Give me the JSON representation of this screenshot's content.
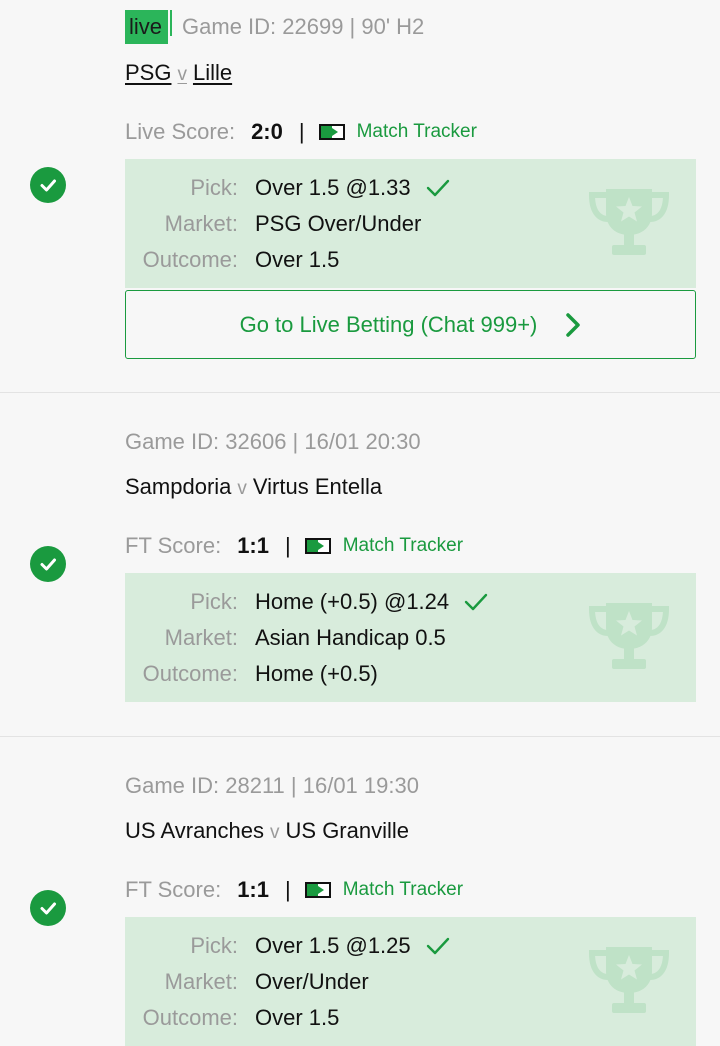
{
  "bets": [
    {
      "live_badge": "live",
      "header": "Game ID: 22699 | 90' H2",
      "home": "PSG",
      "vs": "v",
      "away": "Lille",
      "score_label": "Live Score:",
      "score": "2:0",
      "divider": "|",
      "tracker_label": "Match Tracker",
      "pick_label": "Pick:",
      "pick": "Over 1.5 @1.33",
      "market_label": "Market:",
      "market": "PSG Over/Under",
      "outcome_label": "Outcome:",
      "outcome": "Over 1.5",
      "button_label": "Go to Live Betting (Chat 999+)",
      "status": "won"
    },
    {
      "header": "Game ID: 32606 | 16/01 20:30",
      "home": "Sampdoria",
      "vs": "v",
      "away": "Virtus Entella",
      "score_label": "FT Score:",
      "score": "1:1",
      "divider": "|",
      "tracker_label": "Match Tracker",
      "pick_label": "Pick:",
      "pick": "Home (+0.5) @1.24",
      "market_label": "Market:",
      "market": "Asian Handicap 0.5",
      "outcome_label": "Outcome:",
      "outcome": "Home (+0.5)",
      "status": "won"
    },
    {
      "header": "Game ID: 28211 | 16/01 19:30",
      "home": "US Avranches",
      "vs": "v",
      "away": "US Granville",
      "score_label": "FT Score:",
      "score": "1:1",
      "divider": "|",
      "tracker_label": "Match Tracker",
      "pick_label": "Pick:",
      "pick": "Over 1.5 @1.25",
      "market_label": "Market:",
      "market": "Over/Under",
      "outcome_label": "Outcome:",
      "outcome": "Over 1.5",
      "status": "won"
    }
  ],
  "colors": {
    "accent": "#1a9a3f",
    "live_badge": "#2bb55a",
    "pick_box": "#d8ecdc",
    "muted_text": "#9a9a9a",
    "background": "#f7f7f7"
  },
  "icons": {
    "status": "check-circle-icon",
    "pick_result": "checkmark-icon",
    "tracker": "match-tracker-icon",
    "watermark": "trophy-star-icon",
    "button_arrow": "chevron-right-icon"
  }
}
